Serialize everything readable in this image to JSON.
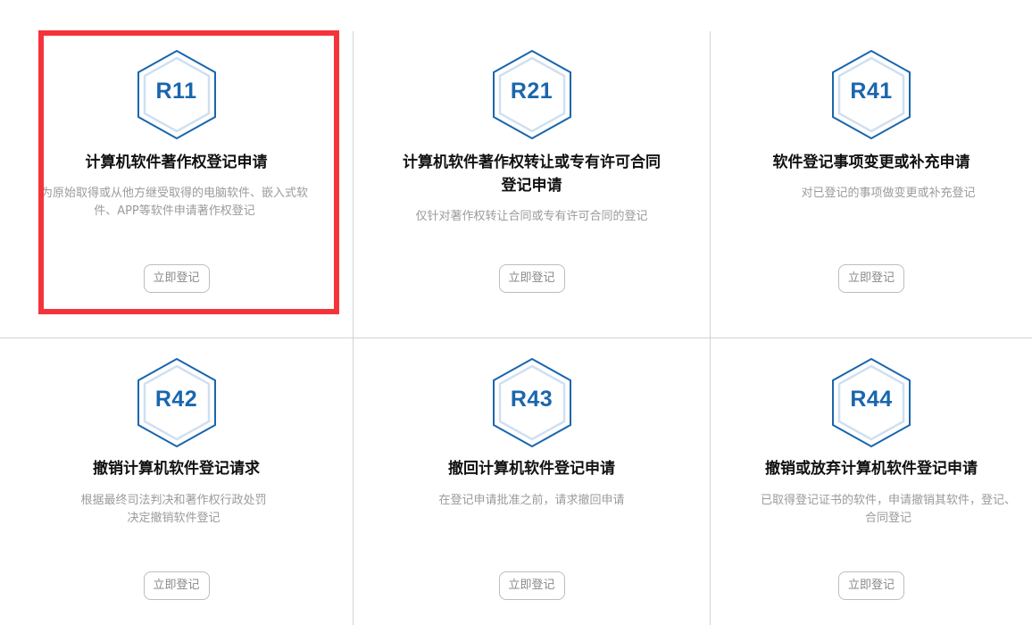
{
  "cards": [
    {
      "code": "R11",
      "title": "计算机软件著作权登记申请",
      "description": "为原始取得或从他方继受取得的电脑软件、嵌入式软件、APP等软件申请著作权登记",
      "button": "立即登记"
    },
    {
      "code": "R21",
      "title": "计算机软件著作权转让或专有许可合同登记申请",
      "description": "仅针对著作权转让合同或专有许可合同的登记",
      "button": "立即登记"
    },
    {
      "code": "R41",
      "title": "软件登记事项变更或补充申请",
      "description": "对已登记的事项做变更或补充登记",
      "button": "立即登记"
    },
    {
      "code": "R42",
      "title": "撤销计算机软件登记请求",
      "description": "根据最终司法判决和著作权行政处罚决定撤销软件登记",
      "button": "立即登记"
    },
    {
      "code": "R43",
      "title": "撤回计算机软件登记申请",
      "description": "在登记申请批准之前，请求撤回申请",
      "button": "立即登记"
    },
    {
      "code": "R44",
      "title": "撤销或放弃计算机软件登记申请",
      "description": "已取得登记证书的软件，申请撤销其软件，登记、合同登记",
      "button": "立即登记"
    }
  ],
  "colors": {
    "hex_outline": "#1a66ad",
    "hex_inner": "#cfe0f1",
    "highlight": "#f5333b",
    "divider": "#d3d3d3"
  },
  "icons": {
    "hexagon": "hexagon-badge-icon"
  }
}
